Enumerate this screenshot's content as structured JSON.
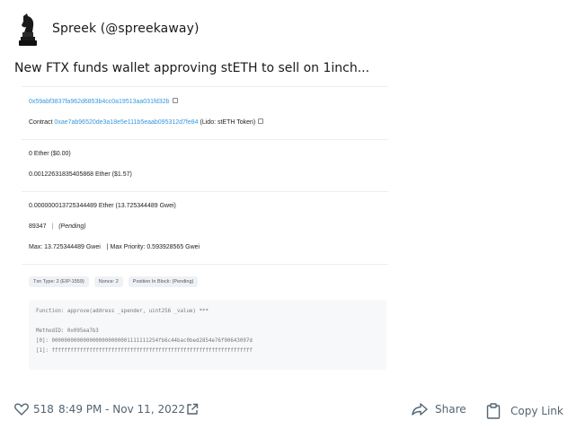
{
  "author": {
    "name_handle": "Spreek (@spreekaway)",
    "avatar_icon": "chess-knight-icon"
  },
  "tweet": {
    "text": "New FTX funds wallet approving stETH to sell on 1inch..."
  },
  "embed": {
    "from_address": "0x59abf3837fa962d6853b4cc0a19513aa031fd32b",
    "contract_label": "Contract",
    "contract_address": "0xae7ab96520de3a18e5e111b5eaab095312d7fe84",
    "contract_name": "(Lido: stETH Token)",
    "value": "0 Ether ($0.00)",
    "fee": "0.001226318354058 68 Ether ($1.57)",
    "fee_display": "0.0012263183540586​8 Ether ($1.57)",
    "gas_price": "0.000000013725344489 Ether (13.725344489 Gwei)",
    "gas_limit": "89347",
    "gas_sep": "|",
    "gas_status": "(Pending)",
    "max_fee": "Max: 13.725344489 Gwei",
    "max_priority": "| Max Priority: 0.593928565 Gwei",
    "pills": [
      "Txn Type: 2 (EIP-1559)",
      "Nonce: 2",
      "Position In Block: (Pending)"
    ],
    "code": {
      "function": "Function: approve(address _spender, uint256 _value) ***",
      "method_id": "MethodID: 0x095ea7b3",
      "param0": "[0]:  0000000000000000000000001111111254fb6c44bac0bed2854e76f90643097d",
      "param1": "[1]:  ffffffffffffffffffffffffffffffffffffffffffffffffffffffffffffffff"
    }
  },
  "footer": {
    "likes": "518",
    "timestamp": "8:49 PM - Nov 11, 2022",
    "share_label": "Share",
    "copy_label": "Copy Link"
  }
}
